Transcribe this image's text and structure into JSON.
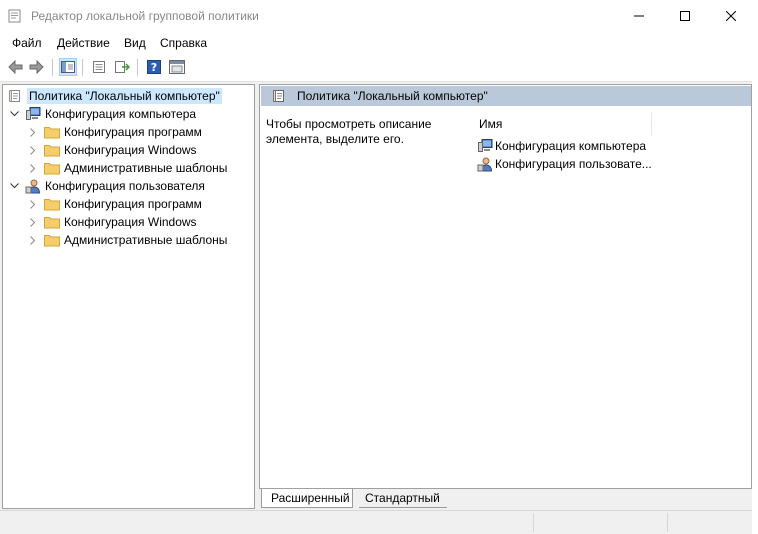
{
  "window": {
    "title": "Редактор локальной групповой политики"
  },
  "menu": {
    "items": [
      "Файл",
      "Действие",
      "Вид",
      "Справка"
    ]
  },
  "toolbar": {
    "buttons": [
      "back-icon",
      "forward-icon",
      "show-hide-tree-icon",
      "properties-icon",
      "export-icon",
      "help-icon",
      "console-icon"
    ]
  },
  "tree": {
    "root": "Политика \"Локальный компьютер\"",
    "computer": "Конфигурация компьютера",
    "computer_children": [
      "Конфигурация программ",
      "Конфигурация Windows",
      "Административные шаблоны"
    ],
    "user": "Конфигурация пользователя",
    "user_children": [
      "Конфигурация программ",
      "Конфигурация Windows",
      "Административные шаблоны"
    ]
  },
  "details": {
    "header": "Политика \"Локальный компьютер\"",
    "description": "Чтобы просмотреть описание элемента, выделите его.",
    "column_name": "Имя",
    "items": [
      "Конфигурация компьютера",
      "Конфигурация пользовате..."
    ]
  },
  "tabs": {
    "extended": "Расширенный",
    "standard": "Стандартный"
  },
  "colors": {
    "selection": "#cce8ff",
    "header_bar": "#b9c9da",
    "folder": "#f5cd6a"
  }
}
